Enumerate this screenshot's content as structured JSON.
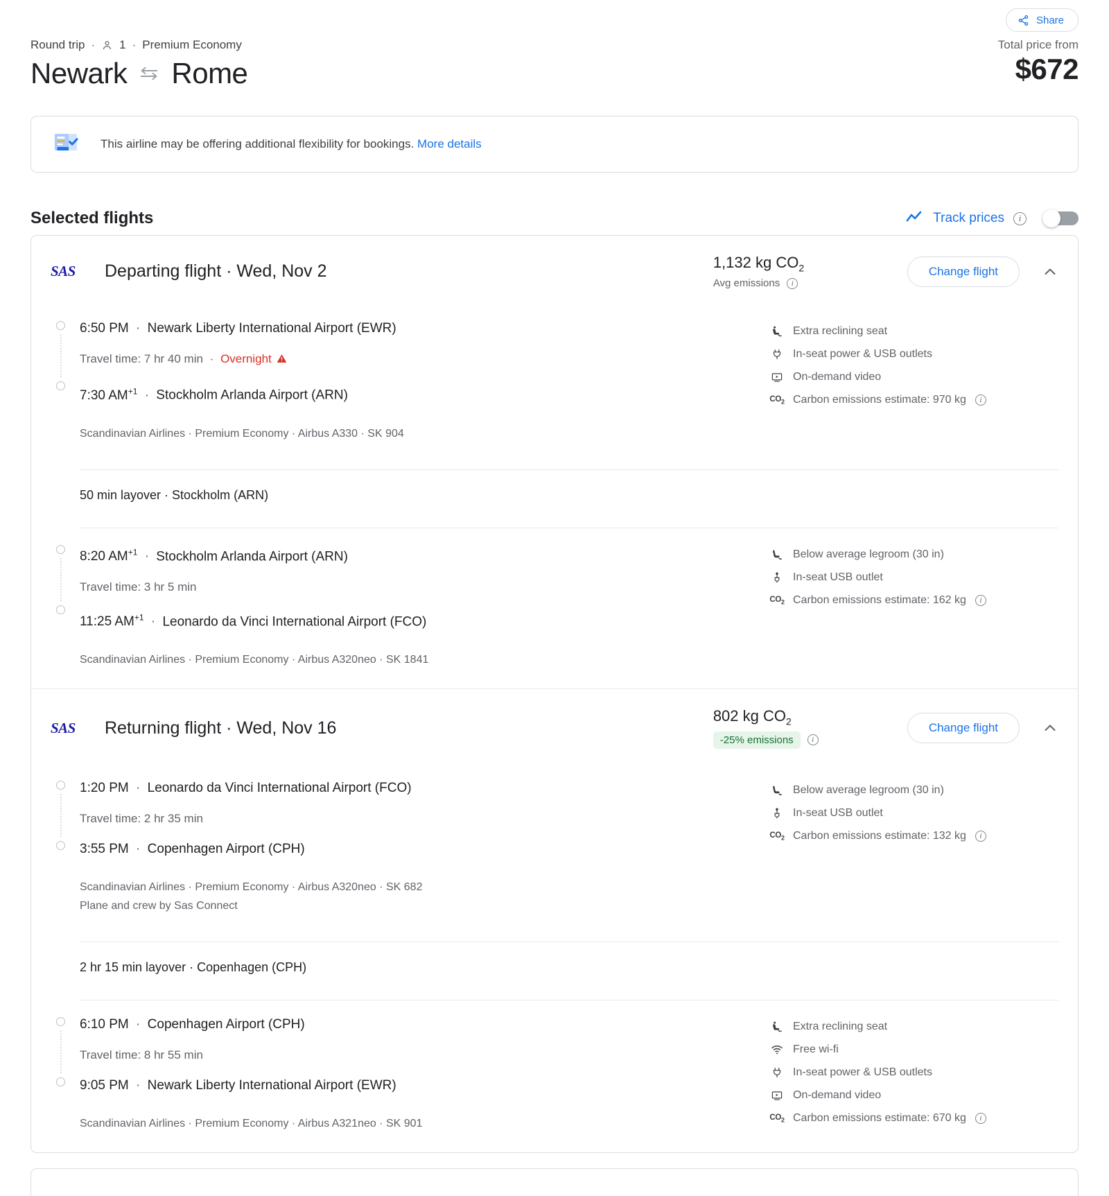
{
  "header": {
    "share_label": "Share",
    "trip_type": "Round trip",
    "passengers": "1",
    "cabin": "Premium Economy",
    "origin": "Newark",
    "destination": "Rome",
    "price_label": "Total price from",
    "price_amount": "$672"
  },
  "notice": {
    "text": "This airline may be offering additional flexibility for bookings.",
    "link": "More details"
  },
  "selected": {
    "title": "Selected flights",
    "track_prices_label": "Track prices",
    "toggle_state": "off"
  },
  "legs": [
    {
      "airline_logo": "SAS",
      "title": "Departing flight · Wed, Nov 2",
      "co2_total": "1,132 kg CO",
      "co2_sub_text": "Avg emissions",
      "co2_badge": "",
      "change_label": "Change flight",
      "segments": [
        {
          "depart_time": "6:50 PM",
          "depart_sup": "",
          "depart_airport": "Newark Liberty International Airport (EWR)",
          "travel_time": "Travel time: 7 hr 40 min",
          "overnight": "Overnight",
          "arrive_time": "7:30 AM",
          "arrive_sup": "+1",
          "arrive_airport": "Stockholm Arlanda Airport (ARN)",
          "operator": "Scandinavian Airlines · Premium Economy · Airbus A330 · SK 904",
          "operator_sub": "",
          "amenities": [
            {
              "icon": "reclining-seat-icon",
              "label": "Extra reclining seat"
            },
            {
              "icon": "power-outlet-icon",
              "label": "In-seat power & USB outlets"
            },
            {
              "icon": "on-demand-video-icon",
              "label": "On-demand video"
            },
            {
              "icon": "co2-icon",
              "label": "Carbon emissions estimate: 970 kg",
              "info": true
            }
          ]
        },
        {
          "layover": "50 min layover · Stockholm (ARN)",
          "depart_time": "8:20 AM",
          "depart_sup": "+1",
          "depart_airport": "Stockholm Arlanda Airport (ARN)",
          "travel_time": "Travel time: 3 hr 5 min",
          "overnight": "",
          "arrive_time": "11:25 AM",
          "arrive_sup": "+1",
          "arrive_airport": "Leonardo da Vinci International Airport (FCO)",
          "operator": "Scandinavian Airlines · Premium Economy · Airbus A320neo · SK 1841",
          "operator_sub": "",
          "amenities": [
            {
              "icon": "legroom-icon",
              "label": "Below average legroom (30 in)"
            },
            {
              "icon": "usb-icon",
              "label": "In-seat USB outlet"
            },
            {
              "icon": "co2-icon",
              "label": "Carbon emissions estimate: 162 kg",
              "info": true
            }
          ]
        }
      ]
    },
    {
      "airline_logo": "SAS",
      "title": "Returning flight · Wed, Nov 16",
      "co2_total": "802 kg CO",
      "co2_sub_text": "",
      "co2_badge": "-25% emissions",
      "change_label": "Change flight",
      "segments": [
        {
          "depart_time": "1:20 PM",
          "depart_sup": "",
          "depart_airport": "Leonardo da Vinci International Airport (FCO)",
          "travel_time": "Travel time: 2 hr 35 min",
          "overnight": "",
          "arrive_time": "3:55 PM",
          "arrive_sup": "",
          "arrive_airport": "Copenhagen Airport (CPH)",
          "operator": "Scandinavian Airlines · Premium Economy · Airbus A320neo · SK 682",
          "operator_sub": "Plane and crew by Sas Connect",
          "amenities": [
            {
              "icon": "legroom-icon",
              "label": "Below average legroom (30 in)"
            },
            {
              "icon": "usb-icon",
              "label": "In-seat USB outlet"
            },
            {
              "icon": "co2-icon",
              "label": "Carbon emissions estimate: 132 kg",
              "info": true
            }
          ]
        },
        {
          "layover": "2 hr 15 min layover · Copenhagen (CPH)",
          "depart_time": "6:10 PM",
          "depart_sup": "",
          "depart_airport": "Copenhagen Airport (CPH)",
          "travel_time": "Travel time: 8 hr 55 min",
          "overnight": "",
          "arrive_time": "9:05 PM",
          "arrive_sup": "",
          "arrive_airport": "Newark Liberty International Airport (EWR)",
          "operator": "Scandinavian Airlines · Premium Economy · Airbus A321neo · SK 901",
          "operator_sub": "",
          "amenities": [
            {
              "icon": "reclining-seat-icon",
              "label": "Extra reclining seat"
            },
            {
              "icon": "wifi-icon",
              "label": "Free wi-fi"
            },
            {
              "icon": "power-outlet-icon",
              "label": "In-seat power & USB outlets"
            },
            {
              "icon": "on-demand-video-icon",
              "label": "On-demand video"
            },
            {
              "icon": "co2-icon",
              "label": "Carbon emissions estimate: 670 kg",
              "info": true
            }
          ]
        }
      ]
    }
  ]
}
